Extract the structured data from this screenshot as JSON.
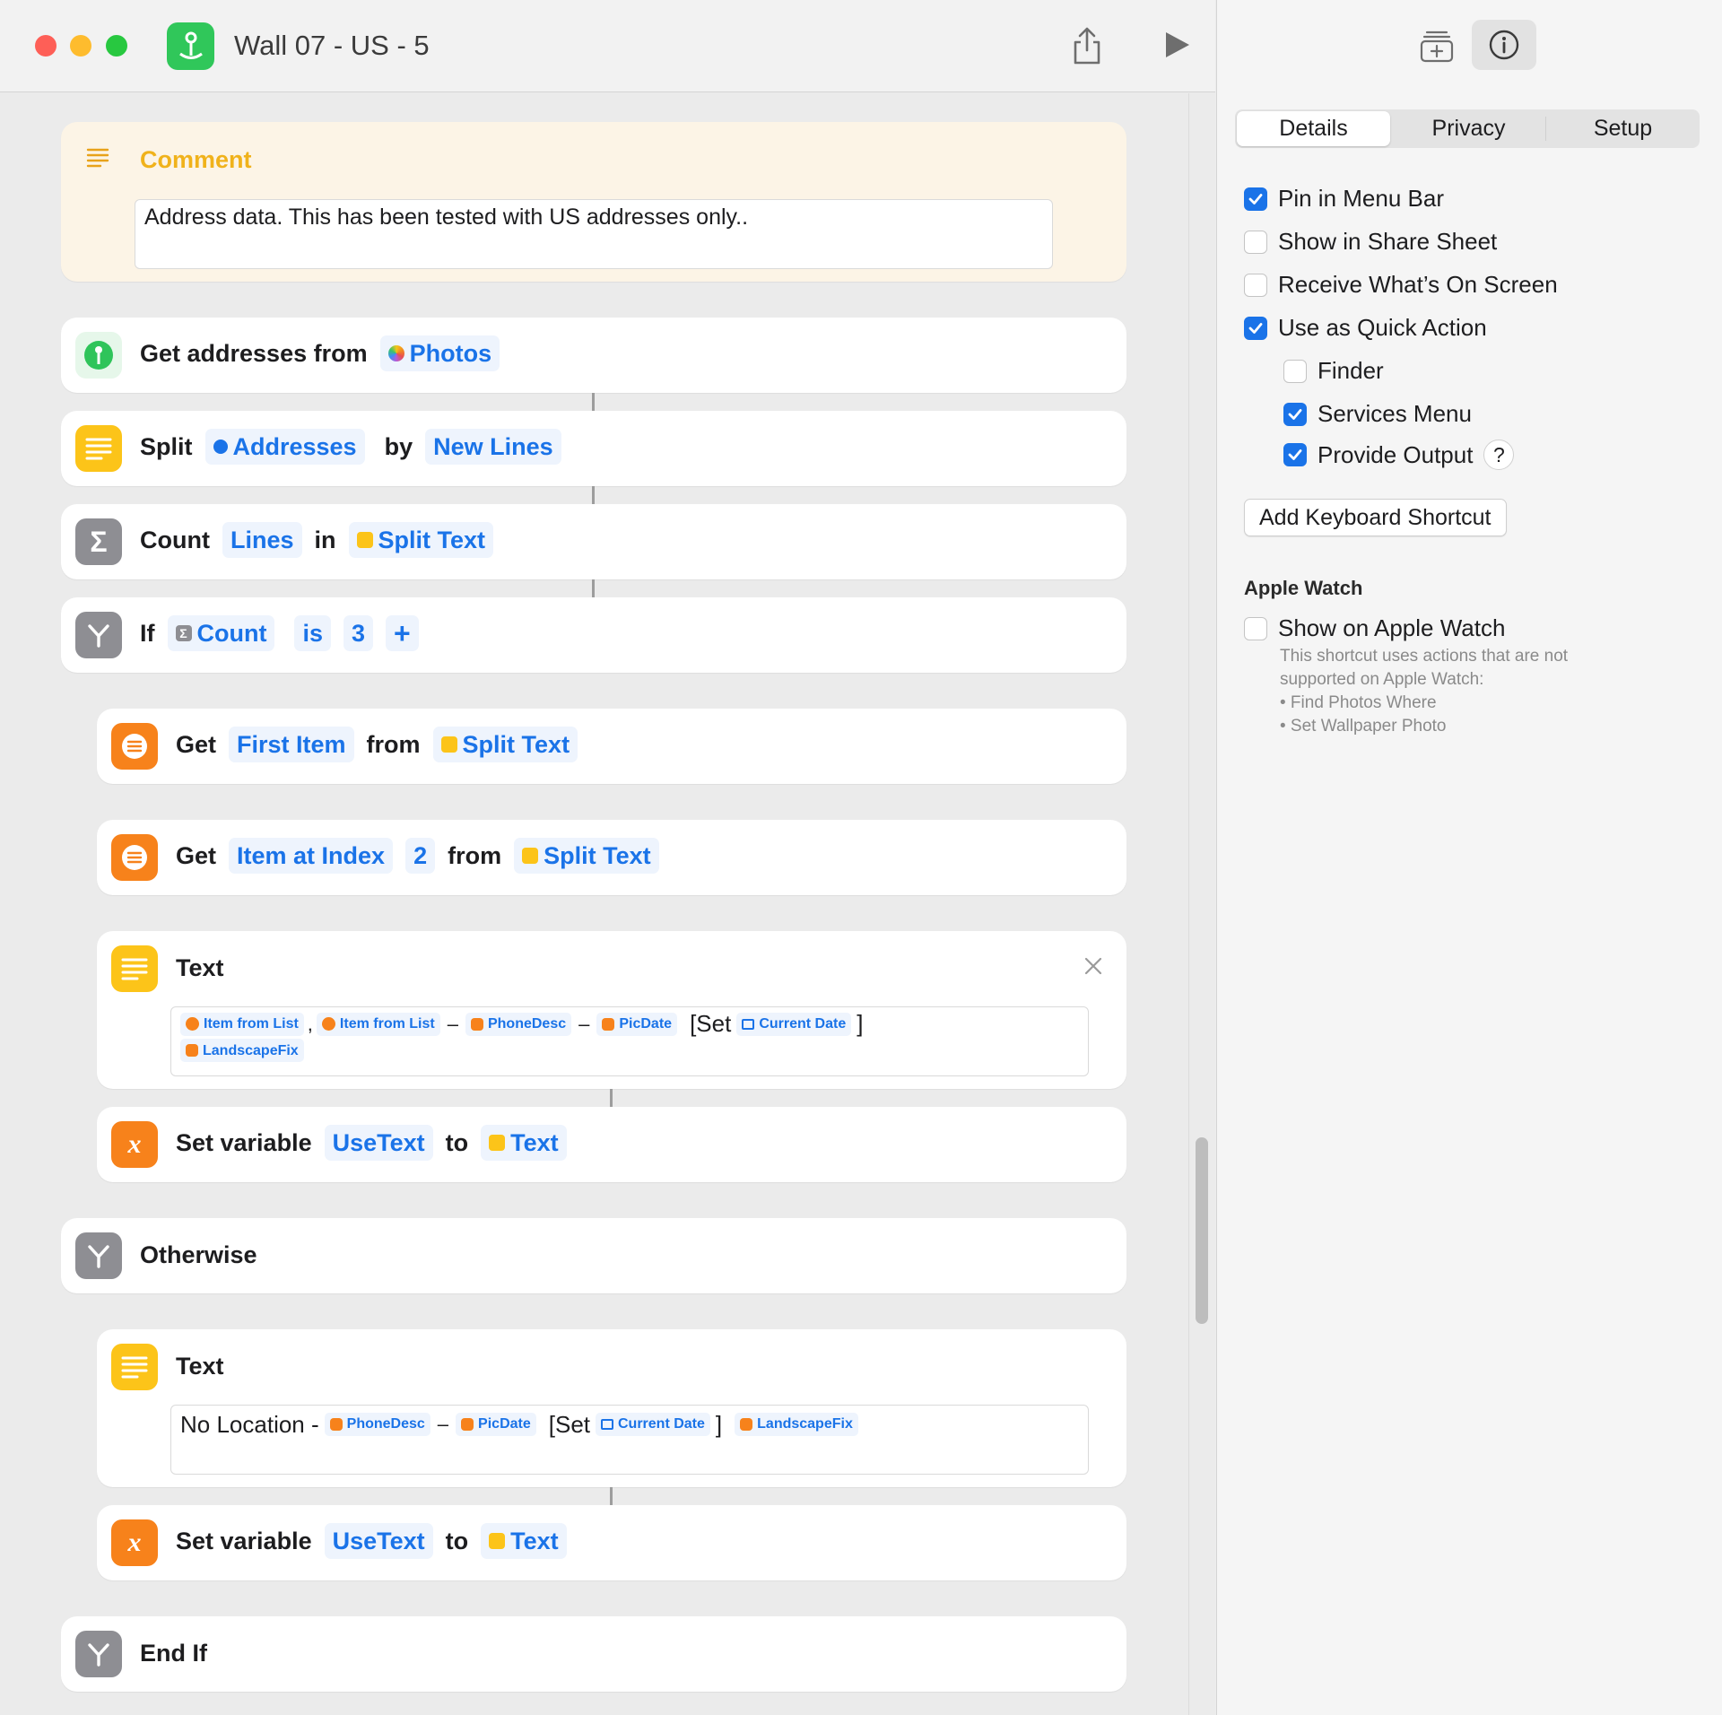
{
  "window": {
    "title": "Wall 07 - US - 5"
  },
  "toolbar": {
    "share_icon": "share-icon",
    "run_icon": "play-icon"
  },
  "sidebar_toolbar": {
    "library_icon": "action-library-icon",
    "info_icon": "info-icon"
  },
  "comment": {
    "label": "Comment",
    "text": "Address data. This has been tested with US addresses only.."
  },
  "actions": {
    "get_addresses": {
      "verb": "Get addresses from",
      "source": "Photos"
    },
    "split": {
      "verb": "Split",
      "input": "Addresses",
      "by": "by",
      "separator": "New Lines"
    },
    "count": {
      "verb": "Count",
      "what": "Lines",
      "in": "in",
      "source": "Split Text"
    },
    "if": {
      "verb": "If",
      "var": "Count",
      "op": "is",
      "value": "3",
      "add": "+"
    },
    "get_first": {
      "verb": "Get",
      "item": "First Item",
      "from": "from",
      "source": "Split Text"
    },
    "get_index": {
      "verb": "Get",
      "item": "Item at Index",
      "index": "2",
      "from": "from",
      "source": "Split Text"
    },
    "text1": {
      "label": "Text",
      "t1": "Item from List",
      "comma": ",",
      "t2": "Item from List",
      "dash1": "–",
      "t3": "PhoneDesc",
      "dash2": "–",
      "t4": "PicDate",
      "set_open": "[Set",
      "t5": "Current Date",
      "close": "]",
      "t6": "LandscapeFix"
    },
    "setvar1": {
      "verb": "Set variable",
      "var": "UseText",
      "to": "to",
      "value": "Text"
    },
    "otherwise": {
      "label": "Otherwise"
    },
    "text2": {
      "label": "Text",
      "prefix": "No Location -",
      "t1": "PhoneDesc",
      "dash": "–",
      "t2": "PicDate",
      "set_open": "[Set",
      "t3": "Current Date",
      "close": "]",
      "t4": "LandscapeFix"
    },
    "setvar2": {
      "verb": "Set variable",
      "var": "UseText",
      "to": "to",
      "value": "Text"
    },
    "endif": {
      "label": "End If"
    }
  },
  "sidebar": {
    "tabs": [
      "Details",
      "Privacy",
      "Setup"
    ],
    "options": [
      {
        "label": "Pin in Menu Bar",
        "checked": true
      },
      {
        "label": "Show in Share Sheet",
        "checked": false
      },
      {
        "label": "Receive What’s On Screen",
        "checked": false
      },
      {
        "label": "Use as Quick Action",
        "checked": true
      },
      {
        "label": "Finder",
        "checked": false
      },
      {
        "label": "Services Menu",
        "checked": true
      },
      {
        "label": "Provide Output",
        "checked": true
      }
    ],
    "help": "?",
    "keyboard_button": "Add Keyboard Shortcut",
    "apple_watch": {
      "title": "Apple Watch",
      "option": "Show on Apple Watch",
      "checked": false,
      "note1": "This shortcut uses actions that are not",
      "note2": "supported on Apple Watch:",
      "bullet1": "• Find Photos Where",
      "bullet2": "• Set Wallpaper Photo"
    }
  },
  "colors": {
    "accent": "#1a73e8",
    "orange": "#f7821b",
    "yellow": "#fcc419",
    "gray": "#8e8e93",
    "green": "#30c75a",
    "comment_bg": "#fcf4e6"
  }
}
